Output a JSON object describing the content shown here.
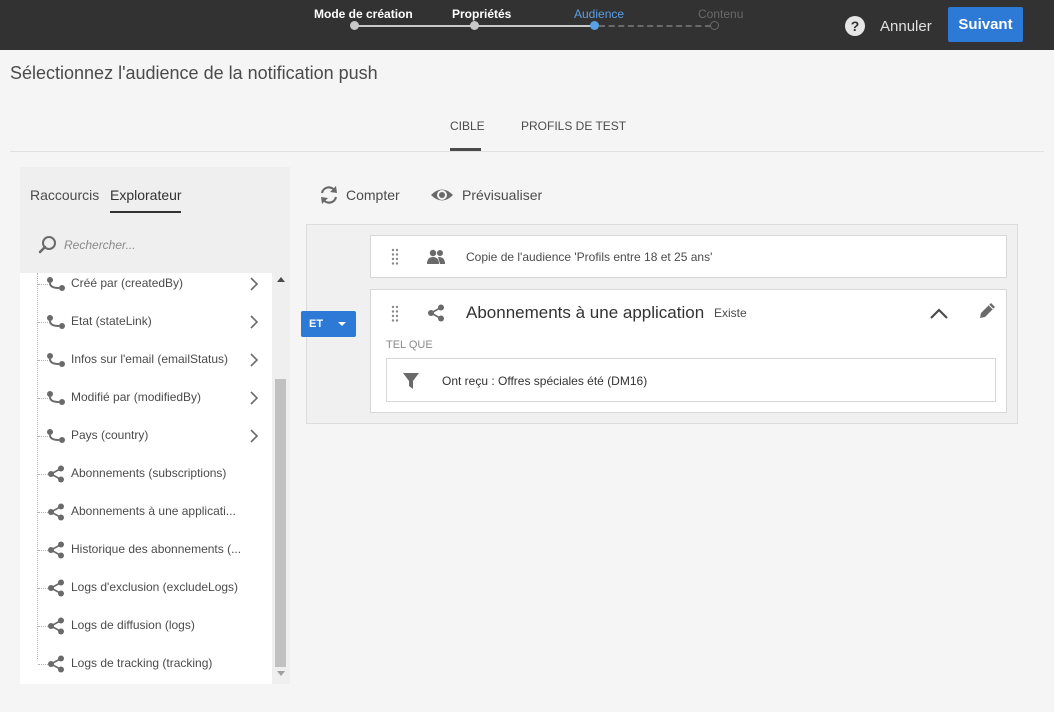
{
  "header": {
    "steps": [
      {
        "label": "Mode de création",
        "state": "done"
      },
      {
        "label": "Propriétés",
        "state": "done"
      },
      {
        "label": "Audience",
        "state": "active"
      },
      {
        "label": "Contenu",
        "state": "future"
      }
    ],
    "help_icon": "?",
    "cancel_label": "Annuler",
    "next_label": "Suivant",
    "accent_color": "#2d7ad6"
  },
  "page": {
    "title": "Sélectionnez l'audience de la notification push",
    "tabs": [
      {
        "label": "CIBLE",
        "active": true
      },
      {
        "label": "PROFILS DE TEST",
        "active": false
      }
    ]
  },
  "left_panel": {
    "tabs": [
      {
        "label": "Raccourcis",
        "active": false
      },
      {
        "label": "Explorateur",
        "active": true
      }
    ],
    "search_placeholder": "Rechercher...",
    "tree_items": [
      {
        "label": "Créé par (createdBy)",
        "icon": "link-icon",
        "has_chevron": true
      },
      {
        "label": "Etat (stateLink)",
        "icon": "link-icon",
        "has_chevron": true
      },
      {
        "label": "Infos sur l'email (emailStatus)",
        "icon": "link-icon",
        "has_chevron": true
      },
      {
        "label": "Modifié par (modifiedBy)",
        "icon": "link-icon",
        "has_chevron": true
      },
      {
        "label": "Pays (country)",
        "icon": "link-icon",
        "has_chevron": true
      },
      {
        "label": "Abonnements (subscriptions)",
        "icon": "share-icon",
        "has_chevron": false
      },
      {
        "label": "Abonnements à une applicati...",
        "icon": "share-icon",
        "has_chevron": false
      },
      {
        "label": "Historique des abonnements (...",
        "icon": "share-icon",
        "has_chevron": false
      },
      {
        "label": "Logs d'exclusion (excludeLogs)",
        "icon": "share-icon",
        "has_chevron": false
      },
      {
        "label": "Logs de diffusion (logs)",
        "icon": "share-icon",
        "has_chevron": false
      },
      {
        "label": "Logs de tracking (tracking)",
        "icon": "share-icon",
        "has_chevron": false
      }
    ]
  },
  "actions": {
    "count_label": "Compter",
    "preview_label": "Prévisualiser"
  },
  "query": {
    "operator_label": "ET",
    "audience_card_label": "Copie de l'audience 'Profils entre 18 et 25 ans'",
    "subscription_card": {
      "title": "Abonnements à une application",
      "condition": "Existe",
      "tel_que": "TEL QUE",
      "filter_label": "Ont reçu : Offres spéciales été (DM16)"
    }
  }
}
